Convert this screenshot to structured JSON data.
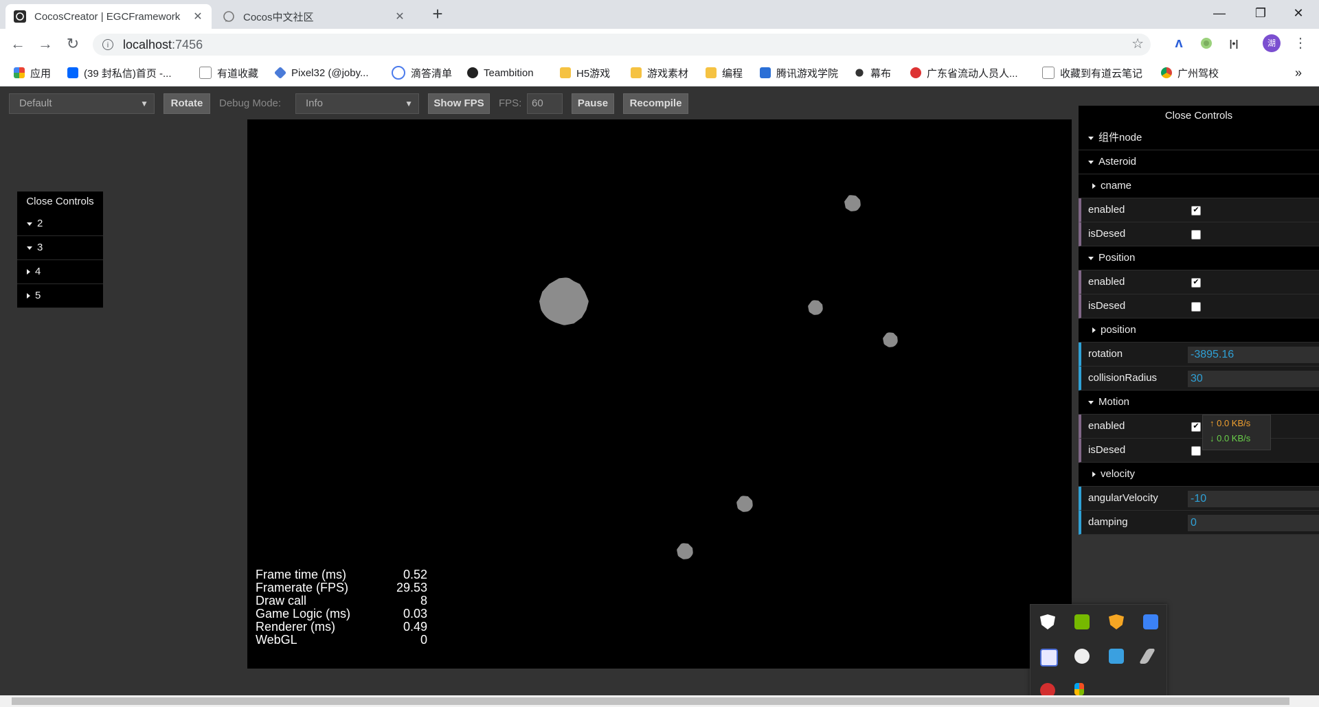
{
  "browser": {
    "tabs": [
      {
        "title": "CocosCreator | EGCFramework",
        "active": true
      },
      {
        "title": "Cocos中文社区",
        "active": false
      }
    ],
    "new_tab": "+",
    "window_controls": {
      "minimize": "—",
      "maximize": "❐",
      "close": "✕"
    },
    "nav": {
      "back": "←",
      "forward": "→",
      "reload": "↻"
    },
    "address": {
      "host": "localhost",
      "port": ":7456",
      "info_icon": "i"
    },
    "profile_initial": "湖",
    "bookmarks": [
      {
        "label": "应用",
        "icon": "apps-grid-icon",
        "color": "#4285f4"
      },
      {
        "label": "(39 封私信)首页 -...",
        "icon": "zhihu-icon",
        "color": "#0066ff"
      },
      {
        "label": "有道收藏",
        "icon": "page-icon",
        "color": "#888888"
      },
      {
        "label": "Pixel32 (@joby...",
        "icon": "cube-icon",
        "color": "#4a7bd8"
      },
      {
        "label": "滴答清单",
        "icon": "check-icon",
        "color": "#4b7bec"
      },
      {
        "label": "Teambition",
        "icon": "teambition-icon",
        "color": "#222222"
      },
      {
        "label": "H5游戏",
        "icon": "folder-icon",
        "color": "#f5c242"
      },
      {
        "label": "游戏素材",
        "icon": "folder-icon",
        "color": "#f5c242"
      },
      {
        "label": "编程",
        "icon": "folder-icon",
        "color": "#f5c242"
      },
      {
        "label": "腾讯游戏学院",
        "icon": "tencent-icon",
        "color": "#2b6fd6"
      },
      {
        "label": "幕布",
        "icon": "mubu-icon",
        "color": "#333333"
      },
      {
        "label": "广东省流动人员人...",
        "icon": "gd-icon",
        "color": "#d33"
      },
      {
        "label": "收藏到有道云笔记",
        "icon": "page-icon",
        "color": "#888888"
      },
      {
        "label": "广州驾校",
        "icon": "chrome-icon",
        "color": "#db4437"
      }
    ],
    "bookmarks_more": "»"
  },
  "preview": {
    "device_select": "Default",
    "rotate_label": "Rotate",
    "debug_label": "Debug Mode:",
    "debug_select": "Info",
    "show_fps_label": "Show FPS",
    "fps_label": "FPS:",
    "fps_value": "60",
    "pause_label": "Pause",
    "recompile_label": "Recompile"
  },
  "stats": [
    {
      "label": "Frame time (ms)",
      "value": "0.52"
    },
    {
      "label": "Framerate (FPS)",
      "value": "29.53"
    },
    {
      "label": "Draw call",
      "value": "8"
    },
    {
      "label": "Game Logic (ms)",
      "value": "0.03"
    },
    {
      "label": "Renderer (ms)",
      "value": "0.49"
    },
    {
      "label": "WebGL",
      "value": "0"
    }
  ],
  "left_gui": {
    "close_label": "Close Controls",
    "folders": [
      {
        "label": "2",
        "open": true
      },
      {
        "label": "3",
        "open": true
      },
      {
        "label": "4",
        "open": false
      },
      {
        "label": "5",
        "open": false
      }
    ]
  },
  "right_gui": {
    "close_label": "Close Controls",
    "root_folder": "组件node",
    "asteroid": {
      "label": "Asteroid",
      "cname": "cname",
      "enabled_label": "enabled",
      "enabled": true,
      "isdesed_label": "isDesed",
      "isdesed": false
    },
    "position": {
      "label": "Position",
      "enabled_label": "enabled",
      "enabled": true,
      "isdesed_label": "isDesed",
      "isdesed": false,
      "position_folder": "position",
      "rotation_label": "rotation",
      "rotation": "-3895.16",
      "radius_label": "collisionRadius",
      "radius": "30"
    },
    "motion": {
      "label": "Motion",
      "enabled_label": "enabled",
      "enabled": true,
      "isdesed_label": "isDesed",
      "isdesed": false,
      "velocity_folder": "velocity",
      "angular_label": "angularVelocity",
      "angular": "-10",
      "damping_label": "damping",
      "damping": "0"
    }
  },
  "net_speed": {
    "up": "↑ 0.0 KB/s",
    "down": "↓ 0.0 KB/s",
    "up_color": "#f0a030",
    "down_color": "#6ad04a"
  },
  "tray_icons": [
    "shield-icon",
    "nvidia-icon",
    "security-icon",
    "feishu-icon",
    "screenshot-icon",
    "steam-icon",
    "display-icon",
    "pen-icon",
    "netease-icon",
    "windows-tile-icon"
  ],
  "colors": {
    "gui_bool": "#806787",
    "gui_number": "#2fa1d6",
    "canvas": "#000000",
    "asteroid": "#8c8c8c"
  }
}
